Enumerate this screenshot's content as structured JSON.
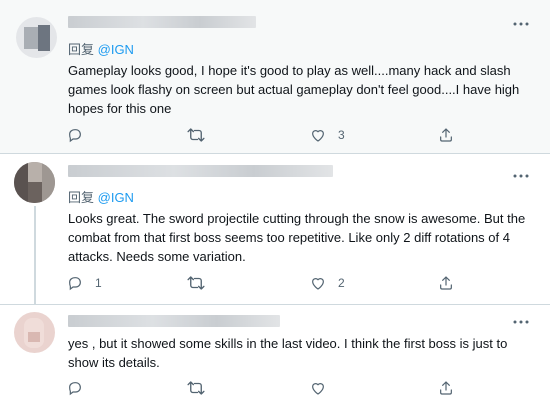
{
  "tweets": [
    {
      "reply_prefix": "回复",
      "reply_handle": "@IGN",
      "text": "Gameplay looks good, I hope it's good to play as well....many hack and slash games look flashy on screen but actual gameplay don't feel good....I have high hopes for this one",
      "reply_count": "",
      "retweet_count": "",
      "like_count": "3"
    },
    {
      "reply_prefix": "回复",
      "reply_handle": "@IGN",
      "text": "Looks great. The sword projectile cutting through the snow is awesome. But the combat from that first boss seems too repetitive. Like only 2 diff rotations of 4 attacks. Needs some variation.",
      "reply_count": "1",
      "retweet_count": "",
      "like_count": "2"
    },
    {
      "reply_prefix": "",
      "reply_handle": "",
      "text": "yes , but it showed some skills in the last video. I think the first boss is just to show its details.",
      "reply_count": "",
      "retweet_count": "",
      "like_count": ""
    }
  ],
  "icons": {
    "reply": "reply-icon",
    "retweet": "retweet-icon",
    "like": "heart-icon",
    "share": "share-icon",
    "more": "more-icon"
  },
  "colors": {
    "text": "#0f1419",
    "secondary": "#536471",
    "accent": "#1d9bf0",
    "divider": "#cfd9de",
    "highlight_bg": "#f7f9f9"
  }
}
